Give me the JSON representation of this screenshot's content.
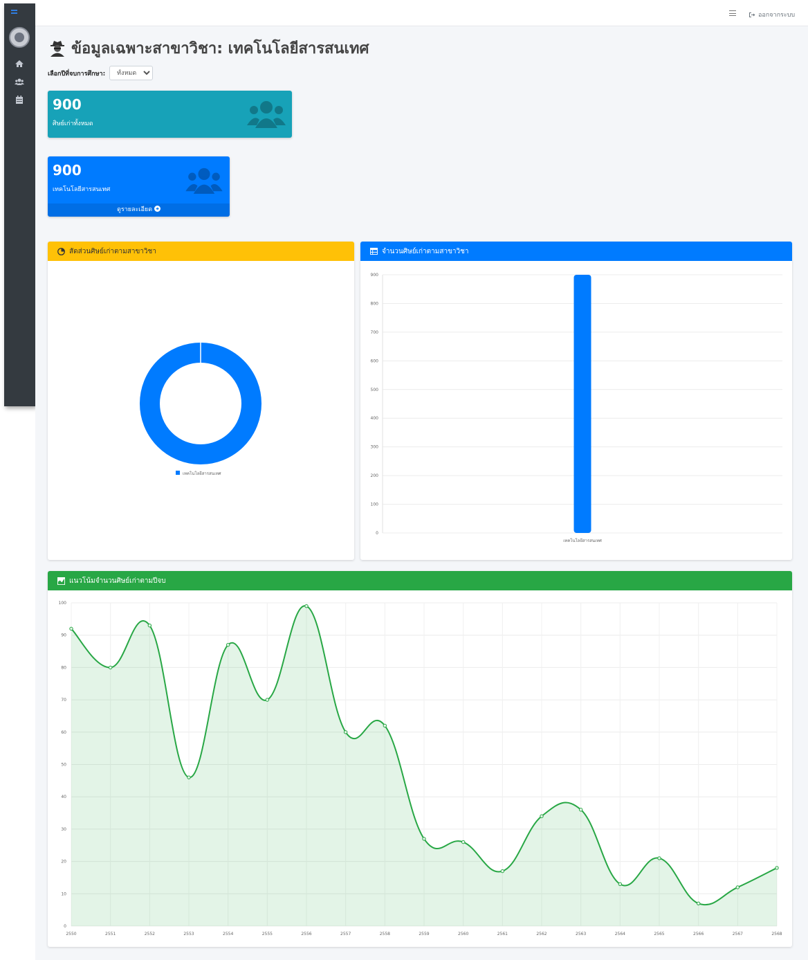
{
  "sidebar": {
    "items": [
      {
        "icon": "home-icon"
      },
      {
        "icon": "users-icon"
      },
      {
        "icon": "calendar-icon"
      }
    ]
  },
  "topbar": {
    "logout_label": "ออกจากระบบ"
  },
  "page": {
    "title": "ข้อมูลเฉพาะสาขาวิชา: เทคโนโลยีสารสนเทศ"
  },
  "filter": {
    "label": "เลือกปีที่จบการศึกษา:",
    "selected": "ทั้งหมด"
  },
  "stats": {
    "total": {
      "value": "900",
      "label": "ศิษย์เก่าทั้งหมด"
    },
    "major": {
      "value": "900",
      "label": "เทคโนโลยีสารสนเทศ",
      "link": "ดูรายละเอียด"
    }
  },
  "colors": {
    "teal": "#17a2b8",
    "blue": "#007bff",
    "yellow": "#ffc107",
    "green": "#28a745"
  },
  "charts": {
    "pie_title": "สัดส่วนศิษย์เก่าตามสาขาวิชา",
    "bar_title": "จำนวนศิษย์เก่าตามสาขาวิชา",
    "line_title": "แนวโน้มจำนวนศิษย์เก่าตามปีจบ"
  },
  "chart_data": [
    {
      "type": "pie",
      "categories": [
        "เทคโนโลยีสารสนเทศ"
      ],
      "values": [
        900
      ],
      "title": "สัดส่วนศิษย์เก่าตามสาขาวิชา",
      "legend": "bottom"
    },
    {
      "type": "bar",
      "categories": [
        "เทคโนโลยีสารสนเทศ"
      ],
      "values": [
        900
      ],
      "title": "จำนวนศิษย์เก่าตามสาขาวิชา",
      "ylim": [
        0,
        900
      ],
      "yticks": [
        0,
        100,
        200,
        300,
        400,
        500,
        600,
        700,
        800,
        900
      ]
    },
    {
      "type": "area",
      "title": "แนวโน้มจำนวนศิษย์เก่าตามปีจบ",
      "x": [
        "2550",
        "2551",
        "2552",
        "2553",
        "2554",
        "2555",
        "2556",
        "2557",
        "2558",
        "2559",
        "2560",
        "2561",
        "2562",
        "2563",
        "2564",
        "2565",
        "2566",
        "2567",
        "2568"
      ],
      "values": [
        92,
        80,
        93,
        46,
        87,
        70,
        99,
        60,
        62,
        27,
        26,
        17,
        34,
        36,
        13,
        21,
        7,
        12,
        18
      ],
      "ylim": [
        0,
        100
      ],
      "yticks": [
        0,
        10,
        20,
        30,
        40,
        50,
        60,
        70,
        80,
        90,
        100
      ]
    }
  ]
}
